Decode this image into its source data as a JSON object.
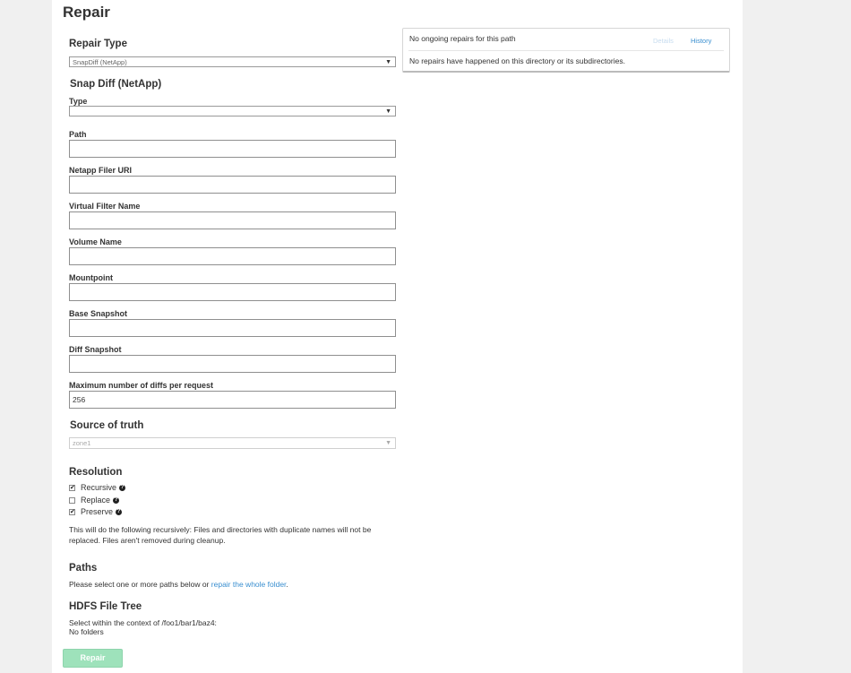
{
  "page": {
    "title": "Repair"
  },
  "repair_type": {
    "label": "Repair Type",
    "selected": "SnapDiff (NetApp)"
  },
  "snapdiff": {
    "title": "Snap Diff (NetApp)",
    "type_label": "Type",
    "type_selected": "",
    "fields": [
      {
        "label": "Path",
        "value": ""
      },
      {
        "label": "Netapp Filer URI",
        "value": ""
      },
      {
        "label": "Virtual Filter Name",
        "value": ""
      },
      {
        "label": "Volume Name",
        "value": ""
      },
      {
        "label": "Mountpoint",
        "value": ""
      },
      {
        "label": "Base Snapshot",
        "value": ""
      },
      {
        "label": "Diff Snapshot",
        "value": ""
      },
      {
        "label": "Maximum number of diffs per request",
        "value": "256"
      }
    ]
  },
  "source_of_truth": {
    "title": "Source of truth",
    "selected": "zone1"
  },
  "resolution": {
    "title": "Resolution",
    "options": [
      {
        "label": "Recursive",
        "checked": true
      },
      {
        "label": "Replace",
        "checked": false
      },
      {
        "label": "Preserve",
        "checked": true
      }
    ],
    "description": "This will do the following recursively: Files and directories with duplicate names will not be replaced. Files aren't removed during cleanup."
  },
  "paths": {
    "title": "Paths",
    "prompt": "Please select one or more paths below or",
    "link": "repair the whole folder",
    "suffix": "."
  },
  "hdfs_tree": {
    "title": "HDFS File Tree",
    "context": "Select within the context of /foo1/bar1/baz4:",
    "empty": "No folders"
  },
  "status": {
    "ongoing": "No ongoing repairs for this path",
    "details_label": "Details",
    "history_label": "History",
    "history_text": "No repairs have happened on this directory or its subdirectories."
  },
  "actions": {
    "repair_label": "Repair"
  },
  "colors": {
    "accent": "#3a8fd0",
    "button": "#9ee2bb",
    "background": "#f0f0f0"
  }
}
